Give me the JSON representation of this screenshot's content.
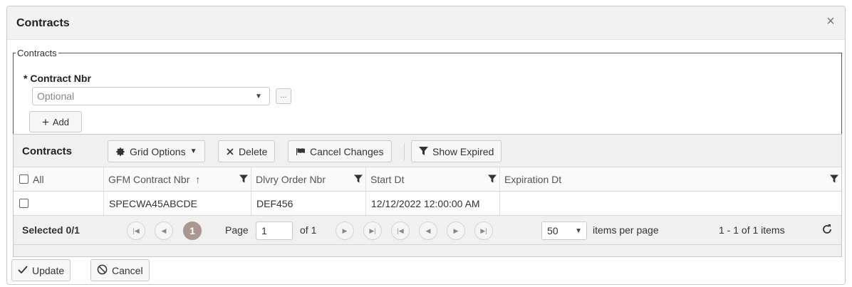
{
  "dialog": {
    "title": "Contracts",
    "close_glyph": "×"
  },
  "form": {
    "group_legend": "Contracts",
    "contract_nbr_label": "* Contract Nbr",
    "contract_nbr_placeholder": "Optional",
    "ellipsis_label": "...",
    "add_label": "Add"
  },
  "grid": {
    "title": "Contracts",
    "toolbar": {
      "grid_options": "Grid Options",
      "delete": "Delete",
      "cancel_changes": "Cancel Changes",
      "show_expired": "Show Expired"
    },
    "columns": {
      "select_all": "All",
      "gfm_contract_nbr": "GFM Contract Nbr",
      "dlvry_order_nbr": "Dlvry Order Nbr",
      "start_dt": "Start Dt",
      "expiration_dt": "Expiration Dt"
    },
    "rows": [
      {
        "gfm_contract_nbr": "SPECWA45ABCDE",
        "dlvry_order_nbr": "DEF456",
        "start_dt": "12/12/2022 12:00:00 AM",
        "expiration_dt": ""
      }
    ],
    "pager": {
      "selected": "Selected 0/1",
      "current_page": "1",
      "page_label": "Page",
      "page_value": "1",
      "of_label": "of 1",
      "page_size": "50",
      "items_per_page": "items per page",
      "summary": "1 - 1 of 1 items"
    }
  },
  "footer": {
    "update": "Update",
    "cancel": "Cancel"
  },
  "icons": {
    "sort": "arrow-up-icon",
    "filter": "funnel-icon",
    "gear": "gear-icon",
    "close": "x-icon",
    "flag": "flag-icon",
    "refresh": "refresh-icon",
    "check": "checkmark-icon",
    "cancel": "ban-icon"
  },
  "colors": {
    "current_page": "#a99791",
    "title_bar": "#f2f2f2",
    "toolbar": "#f0f0f0"
  }
}
